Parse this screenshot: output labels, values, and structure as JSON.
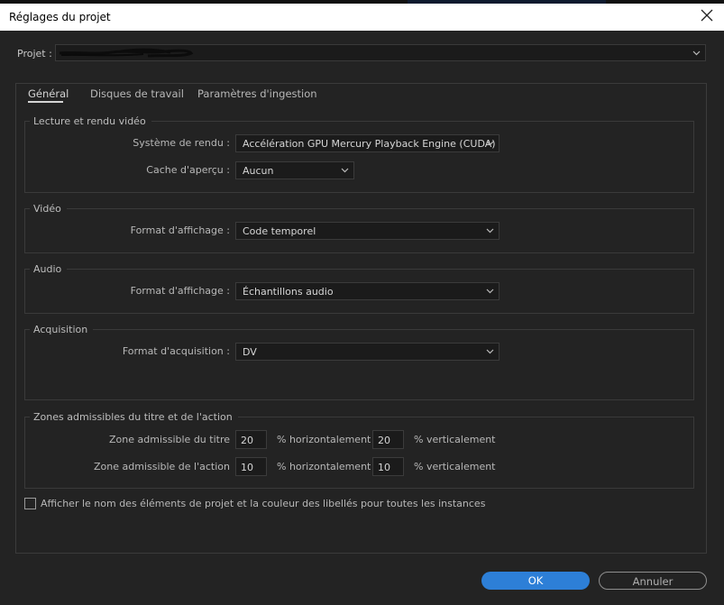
{
  "window": {
    "title": "Réglages du projet"
  },
  "project": {
    "label": "Projet :",
    "value": ""
  },
  "tabs": [
    {
      "label": "Général",
      "active": true
    },
    {
      "label": "Disques de travail",
      "active": false
    },
    {
      "label": "Paramètres d'ingestion",
      "active": false
    }
  ],
  "playback": {
    "legend": "Lecture et rendu vidéo",
    "renderer_label": "Système de rendu :",
    "renderer_value": "Accélération GPU Mercury Playback Engine (CUDA)",
    "cache_label": "Cache d'aperçu :",
    "cache_value": "Aucun"
  },
  "video": {
    "legend": "Vidéo",
    "format_label": "Format d'affichage :",
    "format_value": "Code temporel"
  },
  "audio": {
    "legend": "Audio",
    "format_label": "Format d'affichage :",
    "format_value": "Échantillons audio"
  },
  "acquisition": {
    "legend": "Acquisition",
    "format_label": "Format d'acquisition :",
    "format_value": "DV"
  },
  "safe_zones": {
    "legend": "Zones admissibles du titre et de l'action",
    "title_label": "Zone admissible du titre",
    "title_h": "20",
    "title_v": "20",
    "action_label": "Zone admissible de l'action",
    "action_h": "10",
    "action_v": "10",
    "h_unit": "% horizontalement",
    "v_unit": "% verticalement"
  },
  "option": {
    "label": "Afficher le nom des éléments de projet et la couleur des libellés pour toutes les instances",
    "checked": false
  },
  "buttons": {
    "ok": "OK",
    "cancel": "Annuler"
  },
  "colors": {
    "accent": "#2d7fd7",
    "background": "#232323",
    "field": "#1b1b1b"
  },
  "icons": {
    "close": "close-icon",
    "dropdown": "chevron-down-icon"
  }
}
